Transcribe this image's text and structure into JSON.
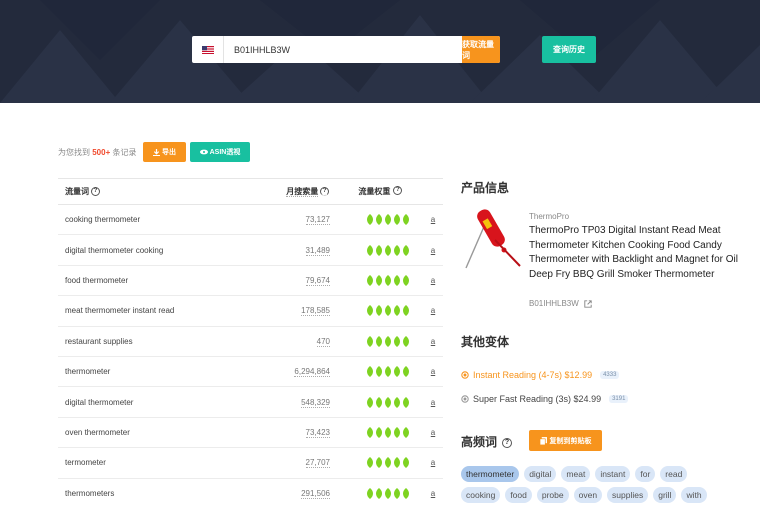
{
  "header": {
    "search_value": "B01IHHLB3W",
    "get_button": "获取流量词",
    "history_button": "查询历史"
  },
  "toolbar": {
    "found_prefix": "为您找到",
    "found_count": "500+",
    "found_suffix": "条记录",
    "export_label": "导出",
    "asin_label": "ASIN透视"
  },
  "table": {
    "columns": [
      "流量词",
      "月搜索量",
      "流量权重"
    ],
    "rows": [
      {
        "keyword": "cooking thermometer",
        "volume": "73,127",
        "weight": 5
      },
      {
        "keyword": "digital thermometer cooking",
        "volume": "31,489",
        "weight": 5
      },
      {
        "keyword": "food thermometer",
        "volume": "79,674",
        "weight": 5
      },
      {
        "keyword": "meat thermometer instant read",
        "volume": "178,585",
        "weight": 5
      },
      {
        "keyword": "restaurant supplies",
        "volume": "470",
        "weight": 5
      },
      {
        "keyword": "thermometer",
        "volume": "6,294,864",
        "weight": 5
      },
      {
        "keyword": "digital thermometer",
        "volume": "548,329",
        "weight": 5
      },
      {
        "keyword": "oven thermometer",
        "volume": "73,423",
        "weight": 5
      },
      {
        "keyword": "termometer",
        "volume": "27,707",
        "weight": 5
      },
      {
        "keyword": "thermometers",
        "volume": "291,506",
        "weight": 5
      }
    ]
  },
  "product": {
    "heading": "产品信息",
    "brand": "ThermoPro",
    "title": "ThermoPro TP03 Digital Instant Read Meat Thermometer Kitchen Cooking Food Candy Thermometer with Backlight and Magnet for Oil Deep Fry BBQ Grill Smoker Thermometer",
    "asin": "B01IHHLB3W"
  },
  "variants": {
    "heading": "其他变体",
    "items": [
      {
        "label": "Instant Reading (4-7s) $12.99",
        "count": "4333",
        "active": true
      },
      {
        "label": "Super Fast Reading (3s) $24.99",
        "count": "3191",
        "active": false
      }
    ]
  },
  "hot": {
    "heading": "高频词",
    "copy_label": "复制到剪贴板",
    "tags": [
      "thermometer",
      "digital",
      "meat",
      "instant",
      "for",
      "read",
      "cooking",
      "food",
      "probe",
      "oven",
      "supplies",
      "grill",
      "with"
    ]
  },
  "colors": {
    "accent_orange": "#f7941d",
    "accent_green": "#18c0a0",
    "header_bg": "#232a3c",
    "leaf_green": "#7ed321"
  }
}
